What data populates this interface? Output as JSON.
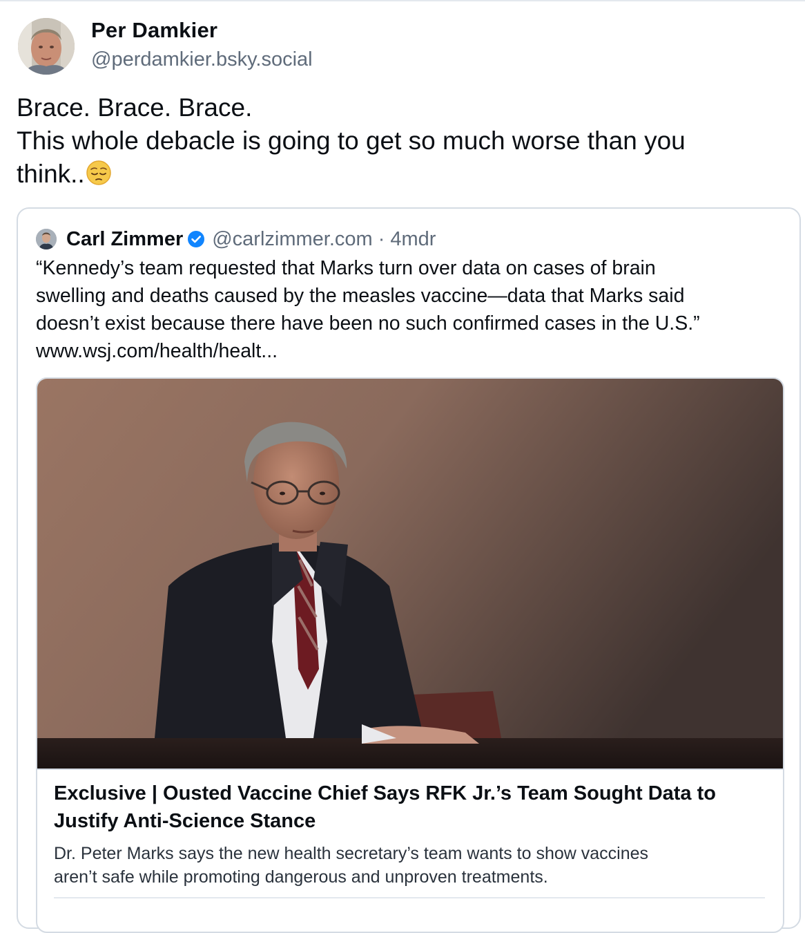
{
  "post": {
    "author": {
      "name": "Per Damkier",
      "handle": "@perdamkier.bsky.social"
    },
    "text_lines": [
      "Brace. Brace. Brace.",
      "This whole debacle is going to get so much worse than you",
      "think.."
    ],
    "emoji": "pensive-face-emoji"
  },
  "quote": {
    "author": {
      "name": "Carl Zimmer",
      "handle": "@carlzimmer.com",
      "verified": true
    },
    "separator": "·",
    "time": "4mdr",
    "text_lines": [
      "“Kennedy’s team requested that Marks turn over data on cases of brain",
      "swelling and deaths caused by the measles vaccine—data that Marks said",
      "doesn’t exist because there have been no such confirmed cases in the U.S.”",
      "www.wsj.com/health/healt..."
    ],
    "link_card": {
      "image": "portrait-photo",
      "title_lines": [
        "Exclusive | Ousted Vaccine Chief Says RFK Jr.’s Team Sought Data to",
        "Justify Anti-Science Stance"
      ],
      "description_lines": [
        "Dr. Peter Marks says the new health secretary’s team wants to show vaccines",
        "aren’t safe while promoting dangerous and unproven treatments."
      ]
    }
  },
  "colors": {
    "text": "#0b0f14",
    "muted": "#5f6b7a",
    "border": "#d4dbe3",
    "verified": "#1185fe"
  }
}
